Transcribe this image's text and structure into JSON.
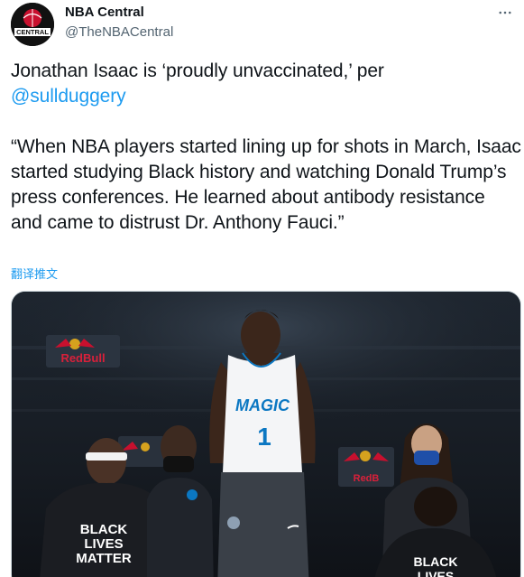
{
  "author": {
    "display_name": "NBA Central",
    "handle": "@TheNBACentral",
    "avatar_text": "CENTRAL"
  },
  "tweet": {
    "line1": "Jonathan Isaac is ‘proudly unvaccinated,’ per",
    "mention": "@sullduggery",
    "quote": "“When NBA players started lining up for shots in March, Isaac started studying Black history and watching Donald Trump’s press conferences. He learned about antibody resistance and came to distrust Dr. Anthony Fauci.”",
    "translate_label": "翻译推文"
  },
  "media": {
    "jersey_text": "MAGIC",
    "jersey_number": "1",
    "shirt_left_text": [
      "BLACK",
      "LIVES",
      "MATTER"
    ],
    "shirt_right_text": [
      "BLACK",
      "LIVES"
    ],
    "banner_text": "RedBull"
  },
  "colors": {
    "link": "#1d9bf0",
    "secondary_text": "#536471",
    "primary_text": "#0f1419"
  },
  "icons": {
    "more": "more-horizontal-icon"
  }
}
